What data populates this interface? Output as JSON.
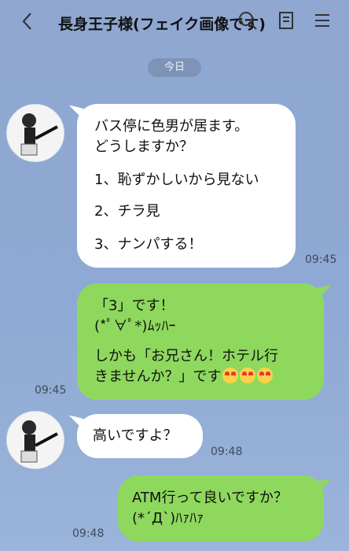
{
  "header": {
    "title": "長身王子様(フェイク画像です)",
    "icons": [
      "back-icon",
      "search-icon",
      "notes-icon",
      "menu-icon"
    ]
  },
  "date_separator": "今日",
  "messages": [
    {
      "side": "left",
      "lines": [
        "バス停に色男が居ます。",
        "どうしますか？",
        "",
        "1、恥ずかしいから見ない",
        "",
        "2、チラ見",
        "",
        "3、ナンパする！"
      ],
      "time": "09:45"
    },
    {
      "side": "right",
      "lines": [
        "「3」です！",
        "(*ﾟ∀ﾟ*)ﾑｯﾊｰ",
        "",
        "しかも「お兄さん！ホテル行",
        "きませんか？」です"
      ],
      "emoji": [
        "heart-eyes-emoji",
        "heart-eyes-emoji",
        "heart-eyes-emoji"
      ],
      "time": "09:45"
    },
    {
      "side": "left",
      "lines": [
        "高いですよ？"
      ],
      "time": "09:48"
    },
    {
      "side": "right",
      "lines": [
        "ATM行って良いですか？",
        "(*´Д`)ﾊｧﾊｧ"
      ],
      "time": "09:48"
    }
  ],
  "colors": {
    "background": "#8fa7d1",
    "left_bubble": "#ffffff",
    "right_bubble": "#8fd85e",
    "date_pill": "#7f93b8"
  }
}
